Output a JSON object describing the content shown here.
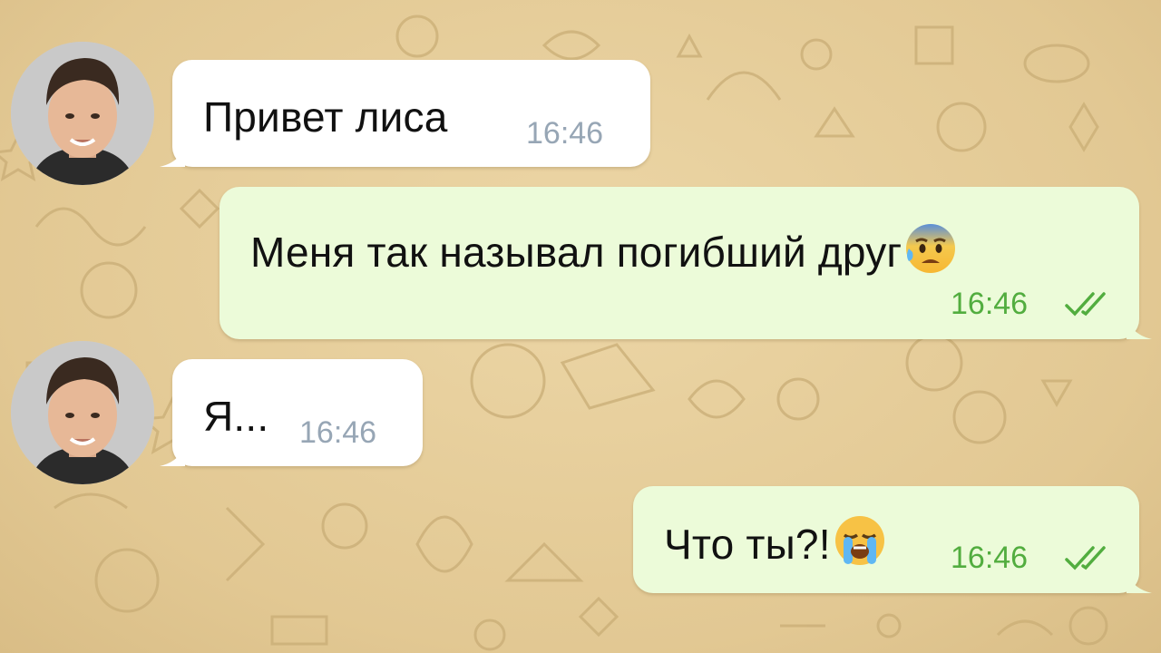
{
  "messages": [
    {
      "direction": "incoming",
      "text": "Привет лиса",
      "time": "16:46"
    },
    {
      "direction": "outgoing",
      "text": "Меня так называл погибший друг",
      "emoji": "anxious-face-with-sweat",
      "time": "16:46",
      "status": "read"
    },
    {
      "direction": "incoming",
      "text": "Я...",
      "time": "16:46"
    },
    {
      "direction": "outgoing",
      "text": "Что ты?!",
      "emoji": "loudly-crying-face",
      "time": "16:46",
      "status": "read"
    }
  ],
  "colors": {
    "background": "#e6cf9c",
    "incoming_bubble": "#ffffff",
    "outgoing_bubble": "#ecfbd9",
    "incoming_time": "#97a6b5",
    "outgoing_time": "#52ad3f"
  },
  "icons": {
    "read_status": "double-check-icon",
    "avatar": "contact-avatar"
  }
}
